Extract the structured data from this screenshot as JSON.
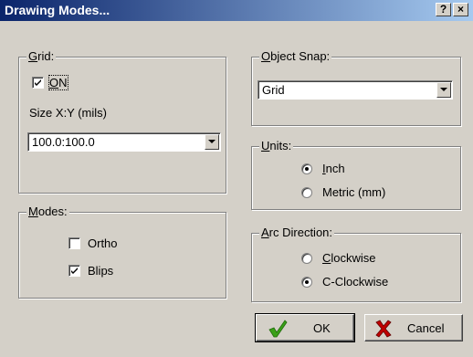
{
  "window": {
    "title": "Drawing Modes...",
    "help_label": "?",
    "close_label": "×"
  },
  "grid": {
    "legend": "Grid:",
    "on_label": "ON",
    "on_checked": true,
    "size_label": "Size X:Y (mils)",
    "size_value": "100.0:100.0"
  },
  "modes": {
    "legend": "Modes:",
    "ortho_label": "Ortho",
    "ortho_checked": false,
    "blips_label": "Blips",
    "blips_checked": true
  },
  "object_snap": {
    "legend": "Object Snap:",
    "value": "Grid"
  },
  "units": {
    "legend": "Units:",
    "options": [
      "Inch",
      "Metric (mm)"
    ],
    "selected": "Inch"
  },
  "arc_direction": {
    "legend": "Arc Direction:",
    "options": [
      "Clockwise",
      "C-Clockwise"
    ],
    "selected": "C-Clockwise"
  },
  "buttons": {
    "ok_label": "OK",
    "cancel_label": "Cancel"
  },
  "colors": {
    "title_start": "#0a246a",
    "title_end": "#a6caf0",
    "dialog_bg": "#d4d0c8",
    "ok_check": "#3aa018",
    "cancel_x": "#c00000"
  }
}
